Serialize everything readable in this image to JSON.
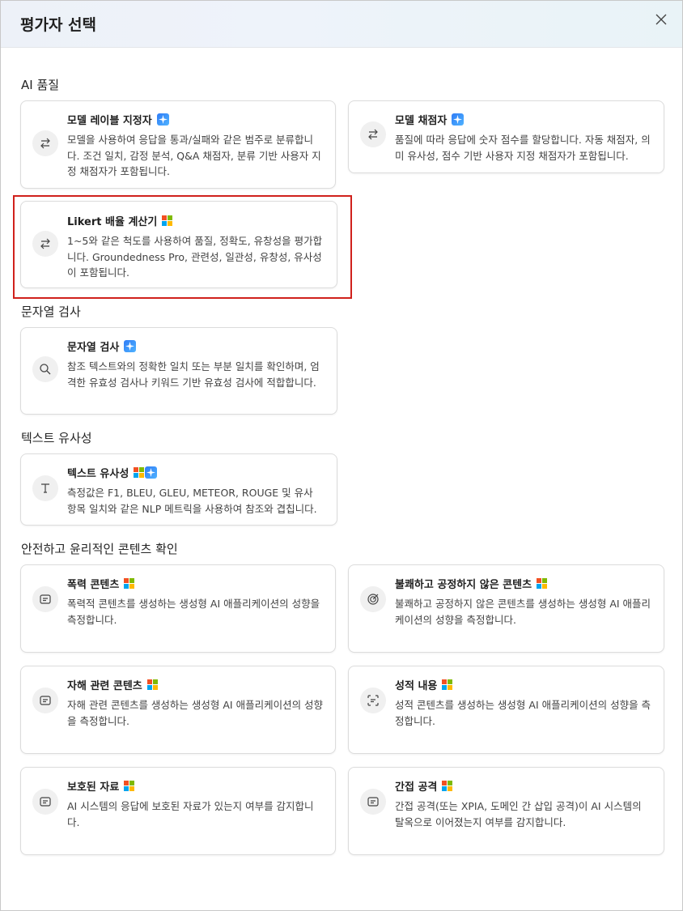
{
  "dialog": {
    "title": "평가자 선택"
  },
  "sections": {
    "ai_quality": "AI 품질",
    "string_check": "문자열 검사",
    "text_similarity": "텍스트 유사성",
    "safety": "안전하고 윤리적인 콘텐츠 확인"
  },
  "cards": {
    "model_labeler": {
      "title": "모델 레이블 지정자",
      "desc": "모델을 사용하여 응답을 통과/실패와 같은 범주로 분류합니다. 조건 일치, 감정 분석, Q&A 채점자, 분류 기반 사용자 지정 채점자가 포함됩니다.",
      "icon": "swap-arrows-icon",
      "badges": [
        "sparkle"
      ]
    },
    "model_scorer": {
      "title": "모델 채점자",
      "desc": "품질에 따라 응답에 숫자 점수를 할당합니다. 자동 채점자, 의미 유사성, 점수 기반 사용자 지정 채점자가 포함됩니다.",
      "icon": "swap-arrows-icon",
      "badges": [
        "sparkle"
      ]
    },
    "likert": {
      "title": "Likert 배율 계산기",
      "desc": "1~5와 같은 척도를 사용하여 품질, 정확도, 유창성을 평가합니다. Groundedness Pro, 관련성, 일관성, 유창성, 유사성이 포함됩니다.",
      "icon": "swap-arrows-icon",
      "badges": [
        "microsoft"
      ]
    },
    "string_check": {
      "title": "문자열 검사",
      "desc": "참조 텍스트와의 정확한 일치 또는 부분 일치를 확인하며, 엄격한 유효성 검사나 키워드 기반 유효성 검사에 적합합니다.",
      "icon": "search-icon",
      "badges": [
        "sparkle"
      ]
    },
    "text_similarity": {
      "title": "텍스트 유사성",
      "desc": "측정값은 F1, BLEU, GLEU, METEOR, ROUGE 및 유사 항목 일치와 같은 NLP 메트릭을 사용하여 참조와 겹칩니다.",
      "icon": "text-icon",
      "badges": [
        "microsoft",
        "sparkle"
      ]
    },
    "violence": {
      "title": "폭력 콘텐츠",
      "desc": "폭력적 콘텐츠를 생성하는 생성형 AI 애플리케이션의 성향을 측정합니다.",
      "icon": "document-icon",
      "badges": [
        "microsoft"
      ]
    },
    "unfair": {
      "title": "불쾌하고 공정하지 않은 콘텐츠",
      "desc": "불쾌하고 공정하지 않은 콘텐츠를 생성하는 생성형 AI 애플리케이션의 성향을 측정합니다.",
      "icon": "target-icon",
      "badges": [
        "microsoft"
      ]
    },
    "self_harm": {
      "title": "자해 관련 콘텐츠",
      "desc": "자해 관련 콘텐츠를 생성하는 생성형 AI 애플리케이션의 성향을 측정합니다.",
      "icon": "document-icon",
      "badges": [
        "microsoft"
      ]
    },
    "sexual": {
      "title": "성적 내용",
      "desc": "성적 콘텐츠를 생성하는 생성형 AI 애플리케이션의 성향을 측정합니다.",
      "icon": "scan-text-icon",
      "badges": [
        "microsoft"
      ]
    },
    "protected": {
      "title": "보호된 자료",
      "desc": "AI 시스템의 응답에 보호된 자료가 있는지 여부를 감지합니다.",
      "icon": "document-icon",
      "badges": [
        "microsoft"
      ]
    },
    "indirect": {
      "title": "간접 공격",
      "desc": "간접 공격(또는 XPIA, 도메인 간 삽입 공격)이 AI 시스템의 탈옥으로 이어졌는지 여부를 감지합니다.",
      "icon": "document-icon",
      "badges": [
        "microsoft"
      ]
    }
  },
  "colors": {
    "ms_red": "#f25022",
    "ms_green": "#7fba00",
    "ms_blue": "#00a4ef",
    "ms_yellow": "#ffb900",
    "highlight": "#d0211c"
  }
}
